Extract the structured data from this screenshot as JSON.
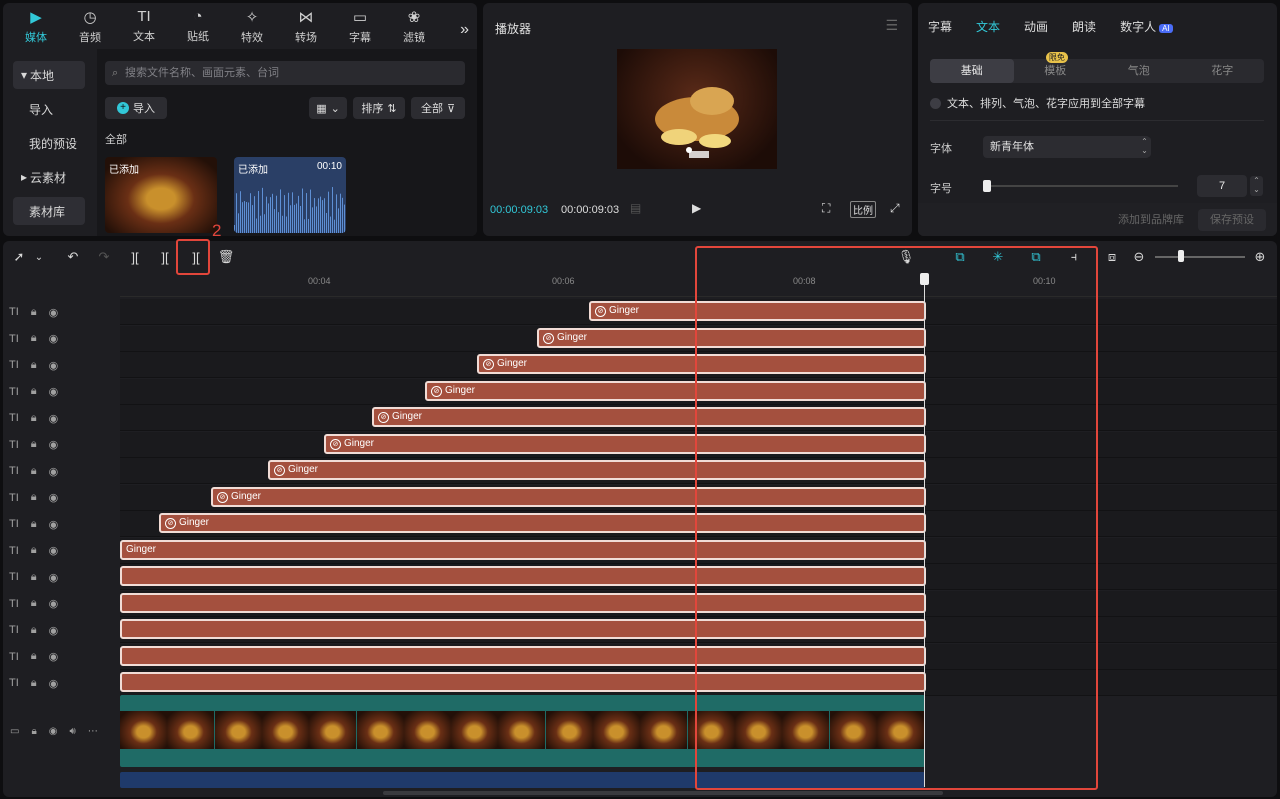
{
  "media_tabs": [
    {
      "label": "媒体",
      "icon": "media-icon"
    },
    {
      "label": "音频",
      "icon": "audio-icon"
    },
    {
      "label": "文本",
      "icon": "text-icon"
    },
    {
      "label": "贴纸",
      "icon": "sticker-icon"
    },
    {
      "label": "特效",
      "icon": "effects-icon"
    },
    {
      "label": "转场",
      "icon": "transition-icon"
    },
    {
      "label": "字幕",
      "icon": "subtitle-icon"
    },
    {
      "label": "滤镜",
      "icon": "filter-icon"
    }
  ],
  "sidenav": [
    "本地",
    "导入",
    "我的预设",
    "云素材",
    "素材库"
  ],
  "search_placeholder": "搜索文件名称、画面元素、台词",
  "import_label": "导入",
  "sort_label": "排序",
  "filter_label": "全部",
  "section_label": "全部",
  "thumbs": [
    {
      "tag": "已添加",
      "duration": ""
    },
    {
      "tag": "已添加",
      "duration": "00:10"
    }
  ],
  "player": {
    "title": "播放器",
    "current_time": "00:00:09:03",
    "total_time": "00:00:09:03",
    "ratio_label": "比例"
  },
  "props": {
    "tabs": [
      "字幕",
      "文本",
      "动画",
      "朗读",
      "数字人"
    ],
    "ai_badge": "AI",
    "segments": [
      "基础",
      "模板",
      "气泡",
      "花字"
    ],
    "limited_badge": "限免",
    "apply_all": "文本、排列、气泡、花字应用到全部字幕",
    "font_label": "字体",
    "font_value": "新青年体",
    "size_label": "字号",
    "size_value": "7",
    "size_fraction": 0.02,
    "add_brand": "添加到品牌库",
    "save_preset": "保存预设"
  },
  "ruler_ticks": [
    "00:04",
    "00:06",
    "00:08",
    "00:10"
  ],
  "annotation_number": "2",
  "clip_text": "Ginger",
  "colors": {
    "accent": "#32c8d8",
    "clip": "#a4503e",
    "highlight": "#e2463b",
    "video_track": "#1f6b66",
    "audio_track": "#1f3a6b"
  }
}
